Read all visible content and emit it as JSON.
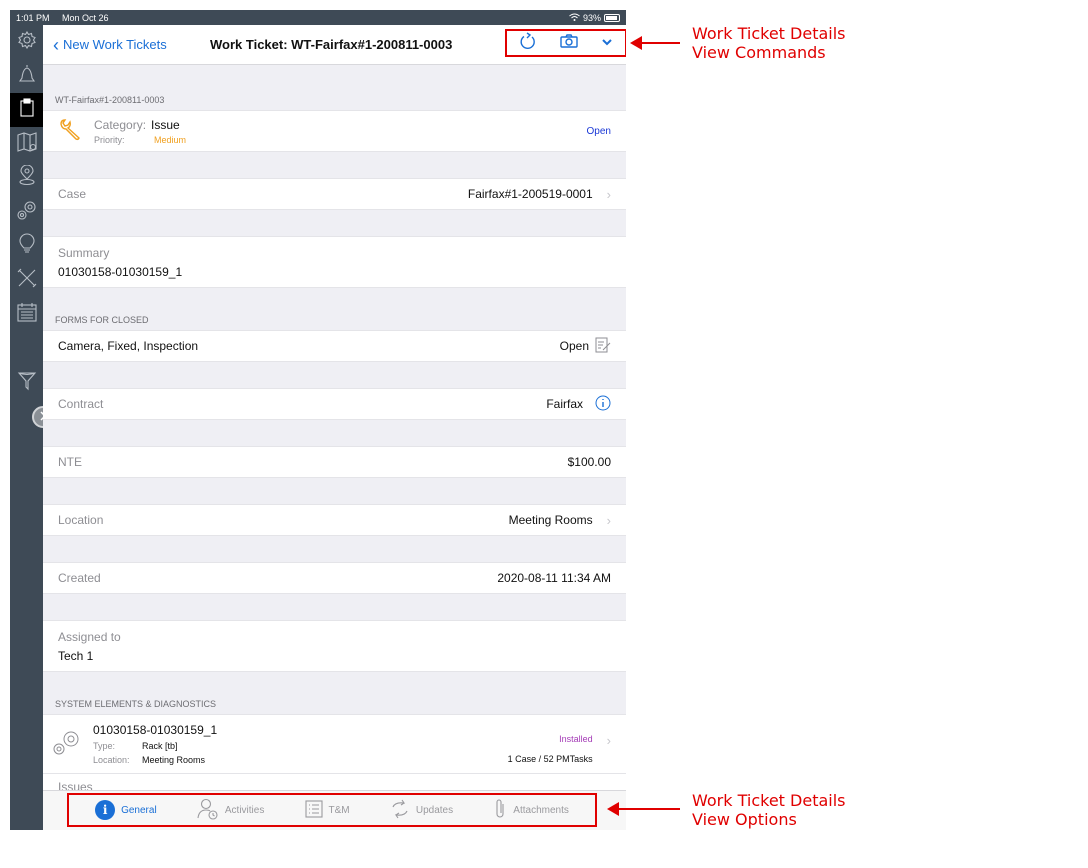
{
  "status_bar": {
    "time": "1:01 PM",
    "date": "Mon Oct 26",
    "battery": "93%"
  },
  "sidebar": {
    "items": [
      {
        "icon": "gear-icon"
      },
      {
        "icon": "bell-icon"
      },
      {
        "icon": "clipboard-icon",
        "active": true
      },
      {
        "icon": "map-icon"
      },
      {
        "icon": "location-pin-icon"
      },
      {
        "icon": "gears-icon"
      },
      {
        "icon": "lightbulb-icon"
      },
      {
        "icon": "tools-icon"
      },
      {
        "icon": "calendar-icon"
      },
      {
        "icon": "filter-icon"
      }
    ]
  },
  "navbar": {
    "back_label": "New Work Tickets",
    "title": "Work Ticket: WT-Fairfax#1-200811-0003",
    "commands": [
      "refresh-icon",
      "camera-icon",
      "chevron-down-icon"
    ]
  },
  "ticket": {
    "id": "WT-Fairfax#1-200811-0003",
    "category_label": "Category:",
    "category": "Issue",
    "priority_label": "Priority:",
    "priority": "Medium",
    "status": "Open",
    "colors": {
      "priority": "#f0a020",
      "status": "#1a38d6",
      "installed": "#a43bb6",
      "accent": "#1a6fd6"
    }
  },
  "fields": {
    "case_label": "Case",
    "case_value": "Fairfax#1-200519-0001",
    "summary_label": "Summary",
    "summary_value": "01030158-01030159_1",
    "forms_header": "FORMS FOR CLOSED",
    "forms_value": "Camera, Fixed, Inspection",
    "forms_action": "Open",
    "contract_label": "Contract",
    "contract_value": "Fairfax",
    "nte_label": "NTE",
    "nte_value": "$100.00",
    "location_label": "Location",
    "location_value": "Meeting Rooms",
    "created_label": "Created",
    "created_value": "2020-08-11 11:34 AM",
    "assigned_label": "Assigned to",
    "assigned_value": "Tech 1"
  },
  "system_elements": {
    "header": "SYSTEM ELEMENTS & DIAGNOSTICS",
    "title": "01030158-01030159_1",
    "type_label": "Type:",
    "type_value": "Rack [tb]",
    "location_label": "Location:",
    "location_value": "Meeting Rooms",
    "status": "Installed",
    "counts": "1 Case / 52 PMTasks",
    "issues_label": "Issues"
  },
  "tabbar": {
    "tabs": [
      {
        "label": "General",
        "active": true
      },
      {
        "label": "Activities"
      },
      {
        "label": "T&M"
      },
      {
        "label": "Updates"
      },
      {
        "label": "Attachments"
      }
    ]
  },
  "annotations": {
    "commands": [
      "Work Ticket Details",
      "View Commands"
    ],
    "options": [
      "Work Ticket Details",
      "View Options"
    ]
  }
}
